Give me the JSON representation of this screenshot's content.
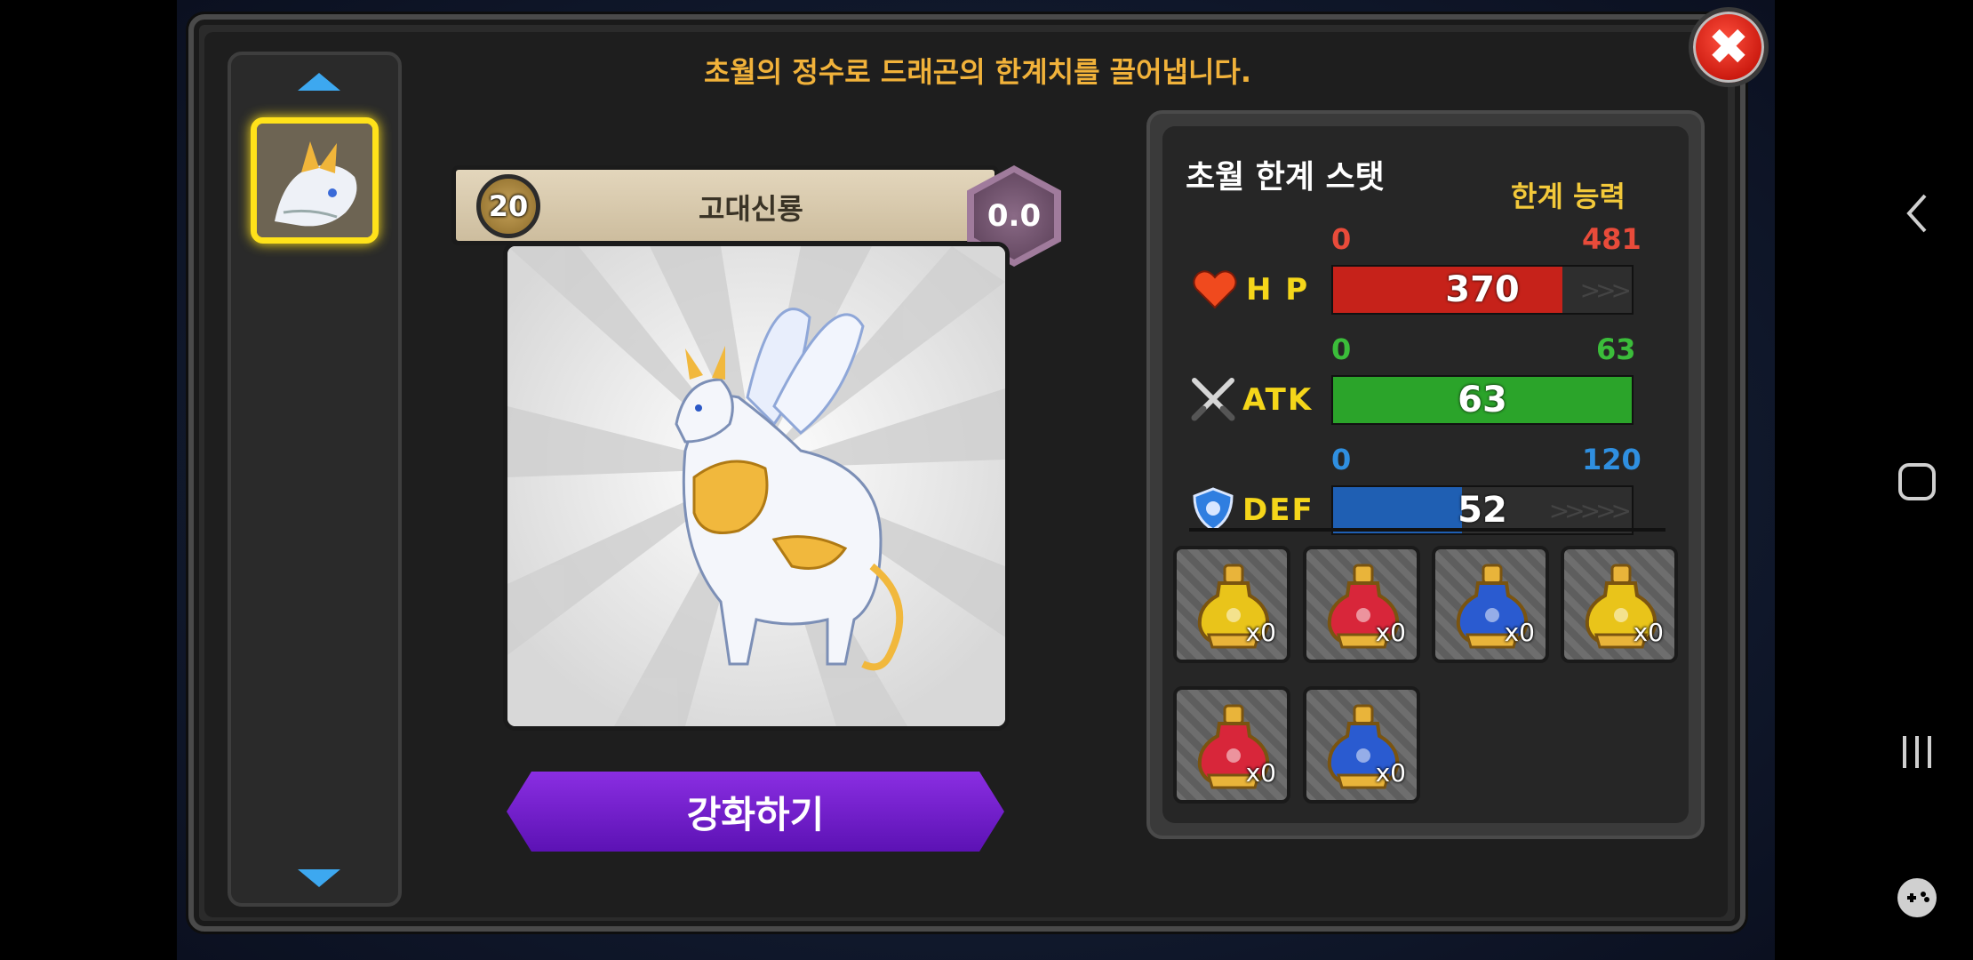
{
  "dialog": {
    "instruction": "초월의 정수로 드래곤의 한계치를 끌어냅니다."
  },
  "dragon": {
    "level": "20",
    "name": "고대신룡",
    "grade": "0.0"
  },
  "enhance_button": "강화하기",
  "stats": {
    "title": "초월 한계 스탯",
    "limit_label": "한계 능력",
    "hp": {
      "label": "H P",
      "min": "0",
      "max": "481",
      "value": "370",
      "fill": 0.769,
      "color": "#c6221a",
      "label_color": "#e84b3a"
    },
    "atk": {
      "label": "ATK",
      "min": "0",
      "max": "63",
      "value": "63",
      "fill": 1.0,
      "color": "#2ba42a",
      "label_color": "#3bbd3a"
    },
    "def": {
      "label": "DEF",
      "min": "0",
      "max": "120",
      "value": "52",
      "fill": 0.433,
      "color": "#1f5fb3",
      "label_color": "#2f8fe0"
    }
  },
  "potions": [
    {
      "name": "yellow-essence",
      "count": "x0",
      "color": "#e9c41a"
    },
    {
      "name": "red-essence",
      "count": "x0",
      "color": "#d8263a"
    },
    {
      "name": "blue-essence",
      "count": "x0",
      "color": "#2a5bd0"
    },
    {
      "name": "large-yellow-essence",
      "count": "x0",
      "color": "#e9c41a"
    },
    {
      "name": "large-red-essence",
      "count": "x0",
      "color": "#d8263a"
    },
    {
      "name": "large-blue-essence",
      "count": "x0",
      "color": "#2a5bd0"
    }
  ],
  "icons": [
    "close-icon",
    "arrow-up-icon",
    "arrow-down-icon",
    "heart-icon",
    "swords-icon",
    "shield-icon",
    "back-icon",
    "home-icon",
    "recents-icon",
    "game-launcher-icon"
  ]
}
